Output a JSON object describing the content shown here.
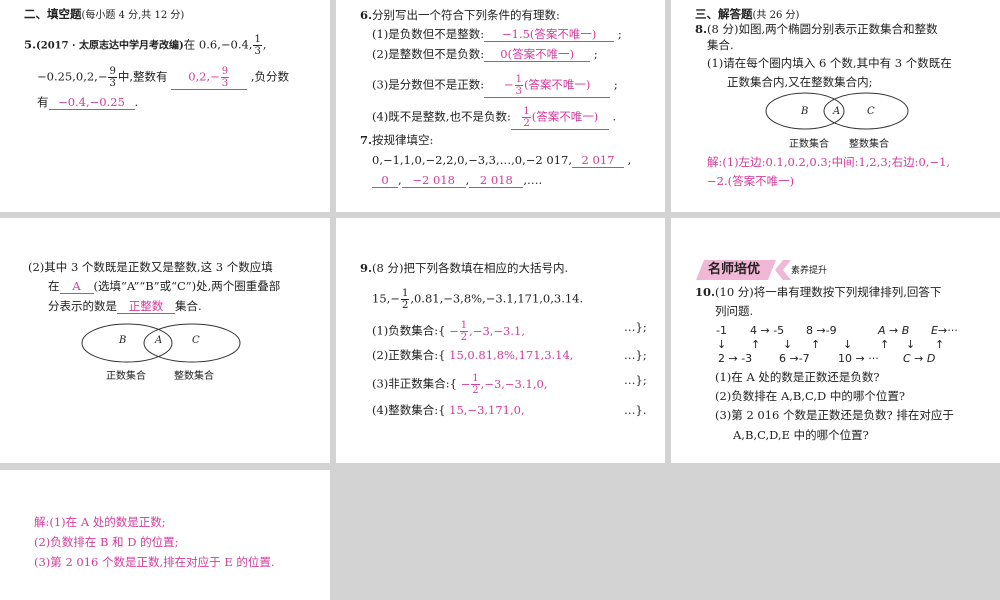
{
  "p1": {
    "section": "二、填空题",
    "section_note": "(每小题 4 分,共 12 分)",
    "q5_num": "5.",
    "q5_src": "(2017 · 太原志达中学月考改编)",
    "q5_a": "在 0.6,−0.4,",
    "q5_f1n": "1",
    "q5_f1d": "3",
    "q5_b": "−0.25,0,2,−",
    "q5_f2n": "9",
    "q5_f2d": "3",
    "q5_c": "中,整数有",
    "q5_ans1": "0,2,−",
    "q5_ans1n": "9",
    "q5_ans1d": "3",
    "q5_d": ",负分数",
    "q5_e": "有",
    "q5_ans2": "−0.4,−0.25",
    "q5_end": "."
  },
  "p2": {
    "q6": "6.",
    "q6_text": "分别写出一个符合下列条件的有理数:",
    "l1": "(1)是负数但不是整数:",
    "a1": "−1.5(答案不唯一)",
    "l2": "(2)是整数但不是负数:",
    "a2": "0(答案不唯一)",
    "l3": "(3)是分数但不是正数:",
    "a3_pre": "−",
    "a3n": "1",
    "a3d": "3",
    "a3_post": "(答案不唯一)",
    "l4": "(4)既不是整数,也不是负数:",
    "a4n": "1",
    "a4d": "2",
    "a4_post": "(答案不唯一)",
    "q7": "7.",
    "q7_text": "按规律填空:",
    "seq": "0,−1,1,0,−2,2,0,−3,3,…,0,−2 017,",
    "b1": "2 017",
    "b2": "0",
    "b3": "−2 018",
    "b4": "2 018",
    "seq_end": ",…."
  },
  "p3": {
    "section": "三、解答题",
    "section_note": "(共 26 分)",
    "q8": "8.",
    "q8_text": "(8 分)如图,两个椭圆分别表示正数集合和整数",
    "q8_text2": "集合.",
    "sub1": "(1)请在每个圈内填入 6 个数,其中有 3 个数既在",
    "sub1b": "正数集合内,又在整数集合内;",
    "venn": {
      "B": "B",
      "A": "A",
      "C": "C",
      "left_label": "正数集合",
      "right_label": "整数集合"
    },
    "ans1": "解:(1)左边:0.1,0.2,0.3;中间:1,2,3;右边:0,−1,",
    "ans2": "−2.(答案不唯一)"
  },
  "p4": {
    "sub2": "(2)其中 3 个数既是正数又是整数,这 3 个数应填",
    "l2a": "在",
    "blank1": "A",
    "l2b": "(选填“A”“B”或“C”)处,两个圈重叠部",
    "l3a": "分表示的数是",
    "blank2": "正整数",
    "l3b": "集合.",
    "venn": {
      "B": "B",
      "A": "A",
      "C": "C",
      "left_label": "正数集合",
      "right_label": "整数集合"
    }
  },
  "p5": {
    "q9": "9.",
    "q9_text": "(8 分)把下列各数填在相应的大括号内.",
    "nums_a": "15,−",
    "nums_fn": "1",
    "nums_fd": "2",
    "nums_b": ",0.81,−3,8%,−3.1,171,0,3.14.",
    "s1": "(1)负数集合:{",
    "s1_pre": "−",
    "s1n": "1",
    "s1d": "2",
    "s1_post": ",−3,−3.1,",
    "s2": "(2)正数集合:{",
    "s2_ans": "15,0.81,8%,171,3.14,",
    "s3": "(3)非正数集合:{",
    "s3_pre": "−",
    "s3n": "1",
    "s3d": "2",
    "s3_post": ",−3,−3.1,0,",
    "s4": "(4)整数集合:{",
    "s4_ans": "15,−3,171,0,",
    "close_semi": "…};",
    "close_dot": "…}."
  },
  "p6": {
    "badge": "名师培优",
    "badge_sub": "素养提升",
    "q10": "10.",
    "q10_text": "(10 分)将一串有理数按下列规律排列,回答下",
    "q10_text2": "列问题.",
    "diagram": {
      "top": [
        "-1",
        "4 → -5",
        "8 →-9",
        "A → B",
        "E→···"
      ],
      "bottom": [
        "2 → -3",
        "6 →-7",
        "10 → ···",
        "C → D"
      ],
      "arrows": [
        "↓",
        "↑",
        "↓",
        "↑",
        "↓",
        "↑",
        "↓",
        "↑"
      ]
    },
    "s1": "(1)在 A 处的数是正数还是负数?",
    "s2": "(2)负数排在 A,B,C,D 中的哪个位置?",
    "s3": "(3)第 2 016 个数是正数还是负数? 排在对应于",
    "s3b": "A,B,C,D,E 中的哪个位置?"
  },
  "p7": {
    "a1": "解:(1)在 A 处的数是正数;",
    "a2": "(2)负数排在 B 和 D 的位置;",
    "a3": "(3)第 2 016 个数是正数,排在对应于 E 的位置."
  },
  "colors": {
    "answer": "#d23c9e",
    "background": "#d3d3d3",
    "badge": "#f1b8d6"
  }
}
